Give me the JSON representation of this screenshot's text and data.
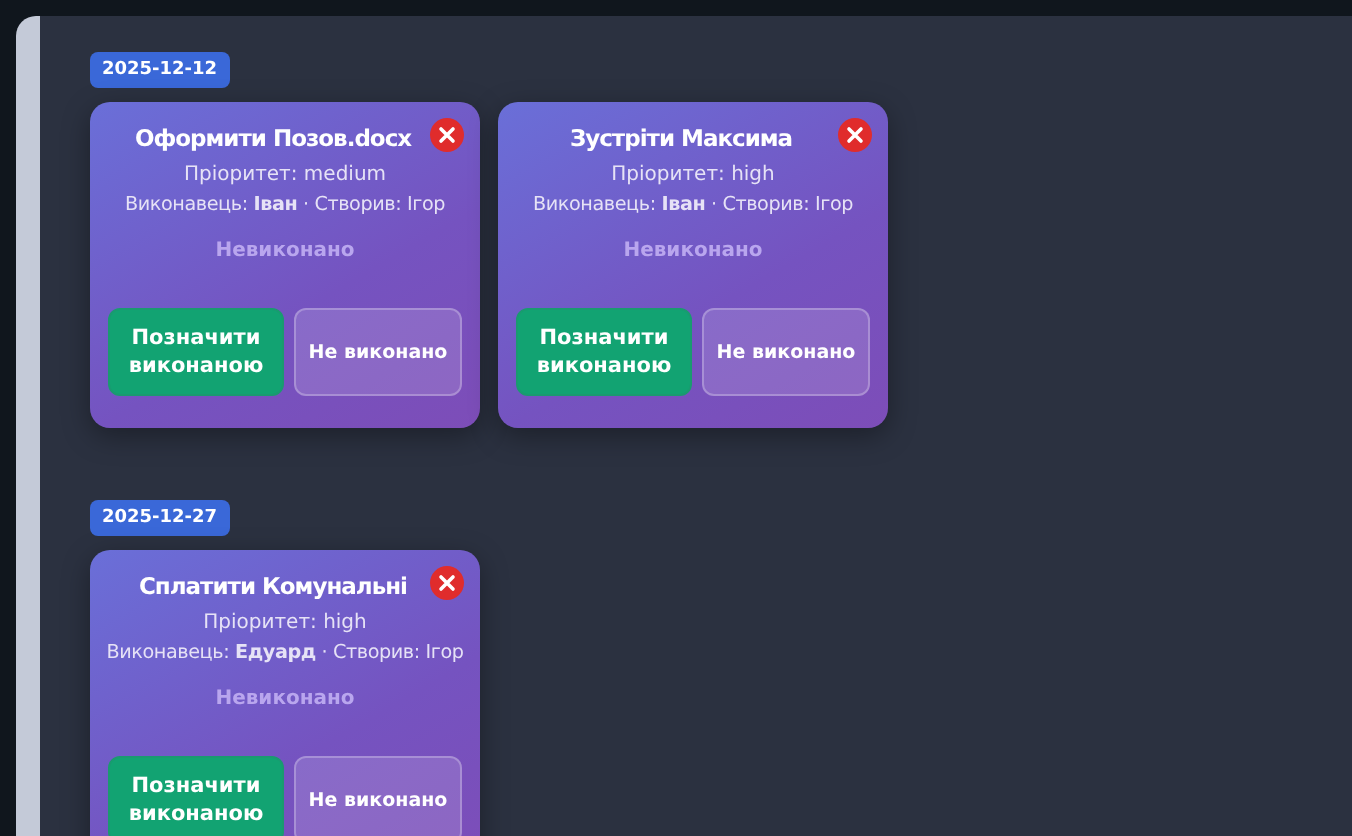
{
  "groups": [
    {
      "date": "2025-12-12",
      "tasks": [
        {
          "title": "Оформити Позов.docx",
          "priority": "Пріоритет: medium",
          "people": "Виконавець: **Іван** · Створив: Ігор",
          "status": "Невиконано",
          "done_button": "Позначити виконаною",
          "undone_button": "Не виконано"
        },
        {
          "title": "Зустріти Максима",
          "priority": "Пріоритет: high",
          "people": "Виконавець: **Іван** · Створив: Ігор",
          "status": "Невиконано",
          "done_button": "Позначити виконаною",
          "undone_button": "Не виконано"
        }
      ]
    },
    {
      "date": "2025-12-27",
      "tasks": [
        {
          "title": "Сплатити Комунальні",
          "priority": "Пріоритет: high",
          "people": "Виконавець: **Едуард** · Створив: Ігор",
          "status": "Невиконано",
          "done_button": "Позначити виконаною",
          "undone_button": "Не виконано"
        }
      ]
    }
  ]
}
